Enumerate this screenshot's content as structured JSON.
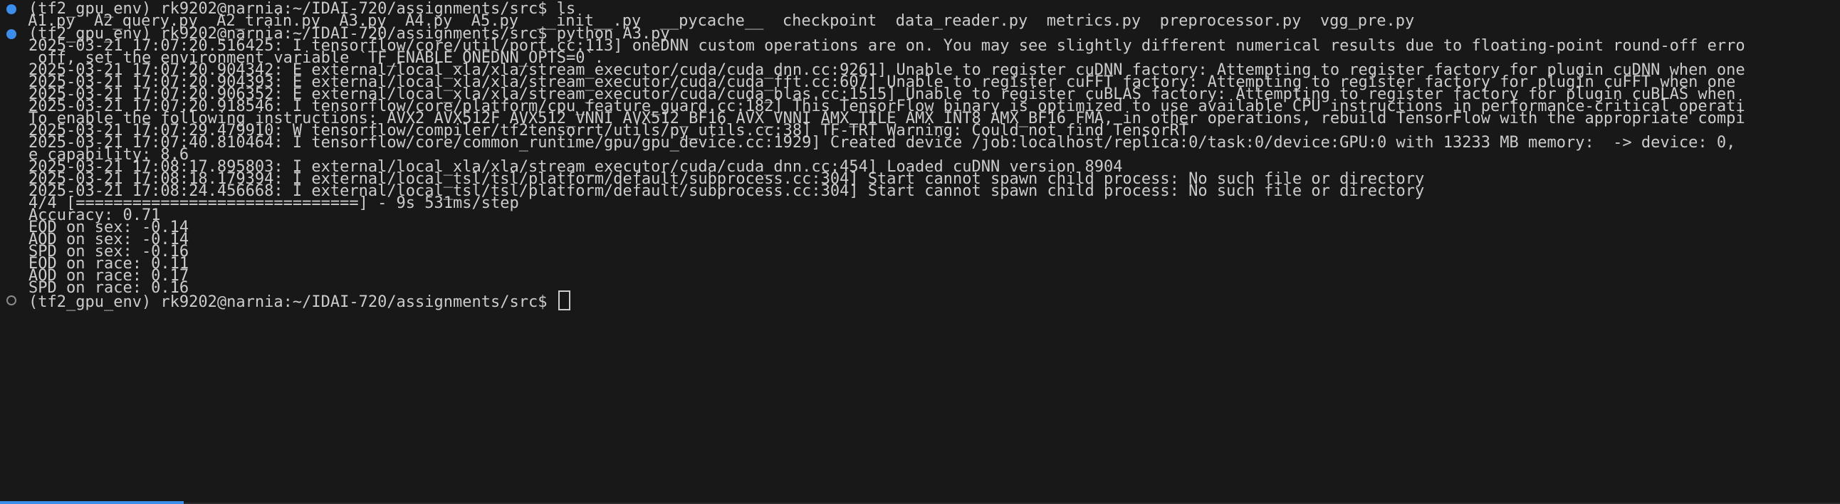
{
  "terminal": {
    "prompt": "(tf2_gpu_env) rk9202@narnia:~/IDAI-720/assignments/src$",
    "ls_command": "ls",
    "ls_output": " A1.py  A2_query.py  A2_train.py  A3.py  A4.py  A5.py  __init__.py  __pycache__  checkpoint  data_reader.py  metrics.py  preprocessor.py  vgg_pre.py",
    "run_command": "python A3.py",
    "log_lines": [
      "2025-03-21 17:07:20.516425: I tensorflow/core/util/port.cc:113] oneDNN custom operations are on. You may see slightly different numerical results due to floating-point round-off erro",
      " off, set the environment variable `TF_ENABLE_ONEDNN_OPTS=0`.",
      "2025-03-21 17:07:20.904342: E external/local_xla/xla/stream_executor/cuda/cuda_dnn.cc:9261] Unable to register cuDNN factory: Attempting to register factory for plugin cuDNN when one",
      "2025-03-21 17:07:20.904393: E external/local_xla/xla/stream_executor/cuda/cuda_fft.cc:607] Unable to register cuFFT factory: Attempting to register factory for plugin cuFFT when one",
      "2025-03-21 17:07:20.906352: E external/local_xla/xla/stream_executor/cuda/cuda_blas.cc:1515] Unable to register cuBLAS factory: Attempting to register factory for plugin cuBLAS when",
      "2025-03-21 17:07:20.918546: I tensorflow/core/platform/cpu_feature_guard.cc:182] This TensorFlow binary is optimized to use available CPU instructions in performance-critical operati",
      "To enable the following instructions: AVX2 AVX512F AVX512_VNNI AVX512_BF16 AVX_VNNI AMX_TILE AMX_INT8 AMX_BF16 FMA, in other operations, rebuild TensorFlow with the appropriate compi",
      "2025-03-21 17:07:29.479910: W tensorflow/compiler/tf2tensorrt/utils/py_utils.cc:38] TF-TRT Warning: Could not find TensorRT",
      "2025-03-21 17:07:40.810464: I tensorflow/core/common_runtime/gpu/gpu_device.cc:1929] Created device /job:localhost/replica:0/task:0/device:GPU:0 with 13233 MB memory:  -> device: 0,",
      "e capability: 8.6",
      "2025-03-21 17:08:17.895803: I external/local_xla/xla/stream_executor/cuda/cuda_dnn.cc:454] Loaded cuDNN version 8904",
      "2025-03-21 17:08:18.179394: I external/local_tsl/tsl/platform/default/subprocess.cc:304] Start cannot spawn child process: No such file or directory",
      "2025-03-21 17:08:24.456668: I external/local_tsl/tsl/platform/default/subprocess.cc:304] Start cannot spawn child process: No such file or directory",
      "4/4 [==============================] - 9s 531ms/step"
    ],
    "metrics": [
      "Accuracy: 0.71",
      "EOD on sex: -0.14",
      "AOD on sex: -0.14",
      "SPD on sex: -0.16",
      "EOD on race: 0.11",
      "AOD on race: 0.17",
      "SPD on race: 0.16"
    ]
  },
  "colors": {
    "background": "#181818",
    "text": "#cccccc",
    "marker_success": "#3b8eea",
    "marker_idle": "#8b8b8b"
  }
}
